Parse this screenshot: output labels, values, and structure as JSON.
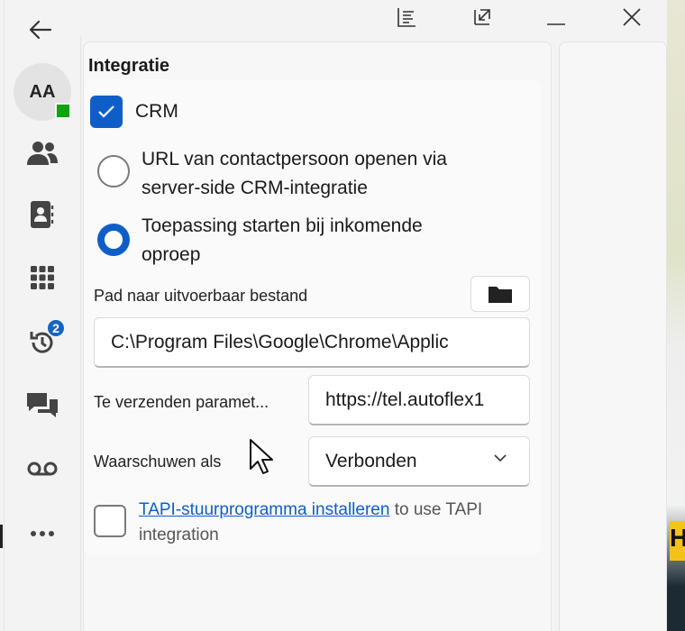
{
  "window": {
    "back_icon": "arrow-left-icon",
    "titlebar_icons": [
      "list-icon",
      "popout-icon",
      "minimize-icon",
      "close-icon"
    ]
  },
  "nav": {
    "avatar_initials": "AA",
    "presence_color": "#13a10e",
    "items": [
      {
        "icon": "people-icon"
      },
      {
        "icon": "contact-card-icon"
      },
      {
        "icon": "dialpad-icon"
      },
      {
        "icon": "history-icon",
        "badge": "2"
      },
      {
        "icon": "chat-icon"
      },
      {
        "icon": "voicemail-icon"
      },
      {
        "icon": "more-icon"
      }
    ]
  },
  "integration": {
    "section_title": "Integratie",
    "crm_label": "CRM",
    "crm_checked": true,
    "option_url_line1": "URL van contactpersoon openen via",
    "option_url_line2": "server-side CRM-integratie",
    "option_app_line1": "Toepassing starten bij inkomende",
    "option_app_line2": "oproep",
    "selected_option": "app",
    "path_label": "Pad naar uitvoerbaar bestand",
    "path_value": "C:\\Program Files\\Google\\Chrome\\Applic",
    "params_label": "Te verzenden paramet...",
    "params_value": "https://tel.autoflex1",
    "warn_label": "Waarschuwen als",
    "warn_value": "Verbonden",
    "tapi_link": "TAPI-stuurprogramma installeren",
    "tapi_text": " to use TAPI integration",
    "tapi_checked": false
  },
  "colors": {
    "accent": "#0f5ec8",
    "badge": "#1565c0"
  },
  "background": {
    "visible_letter": "H"
  }
}
